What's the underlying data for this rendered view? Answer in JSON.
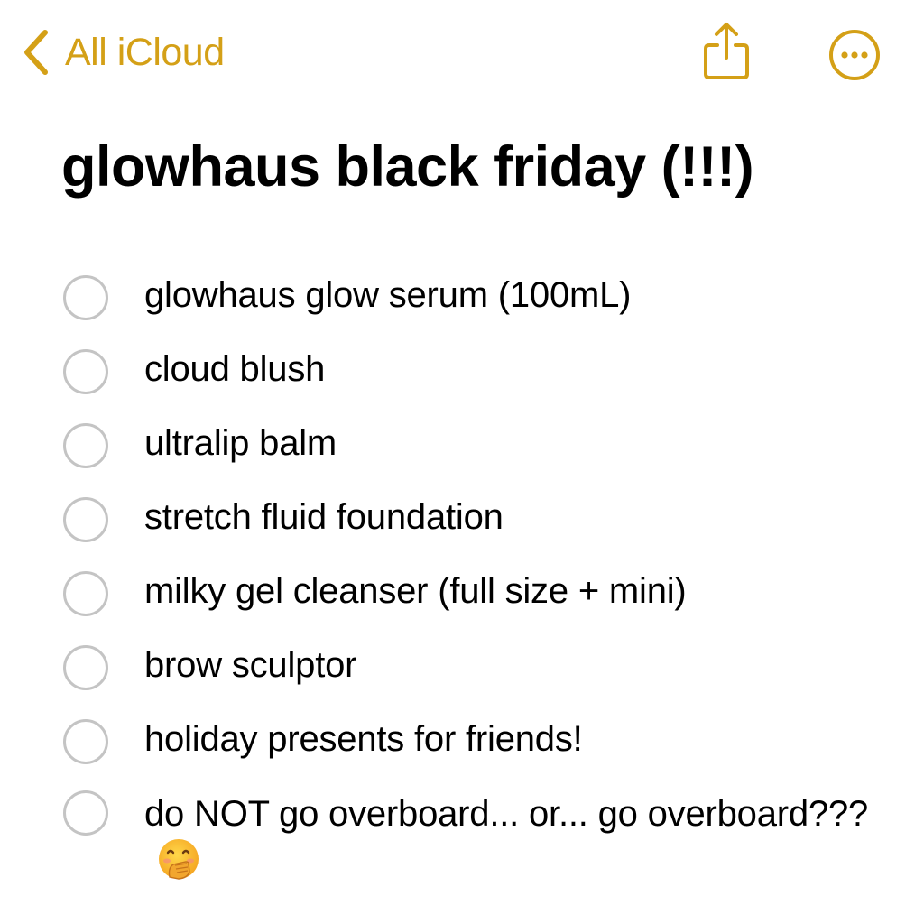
{
  "nav": {
    "back_label": "All iCloud",
    "accent_color": "#D4A017",
    "back_icon": "chevron-left-icon",
    "share_icon": "share-icon",
    "more_icon": "ellipsis-circle-icon"
  },
  "note": {
    "title": "glowhaus black friday (!!!)",
    "checklist": [
      {
        "text": "glowhaus glow serum (100mL)",
        "checked": false
      },
      {
        "text": "cloud blush",
        "checked": false
      },
      {
        "text": "ultralip balm",
        "checked": false
      },
      {
        "text": "stretch fluid foundation",
        "checked": false
      },
      {
        "text": "milky gel cleanser (full size + mini)",
        "checked": false
      },
      {
        "text": "brow sculptor",
        "checked": false
      },
      {
        "text": "holiday presents for friends!",
        "checked": false
      },
      {
        "text": "do NOT go overboard... or... go overboard???",
        "checked": false,
        "emoji": "face-with-hand-over-mouth"
      }
    ]
  }
}
